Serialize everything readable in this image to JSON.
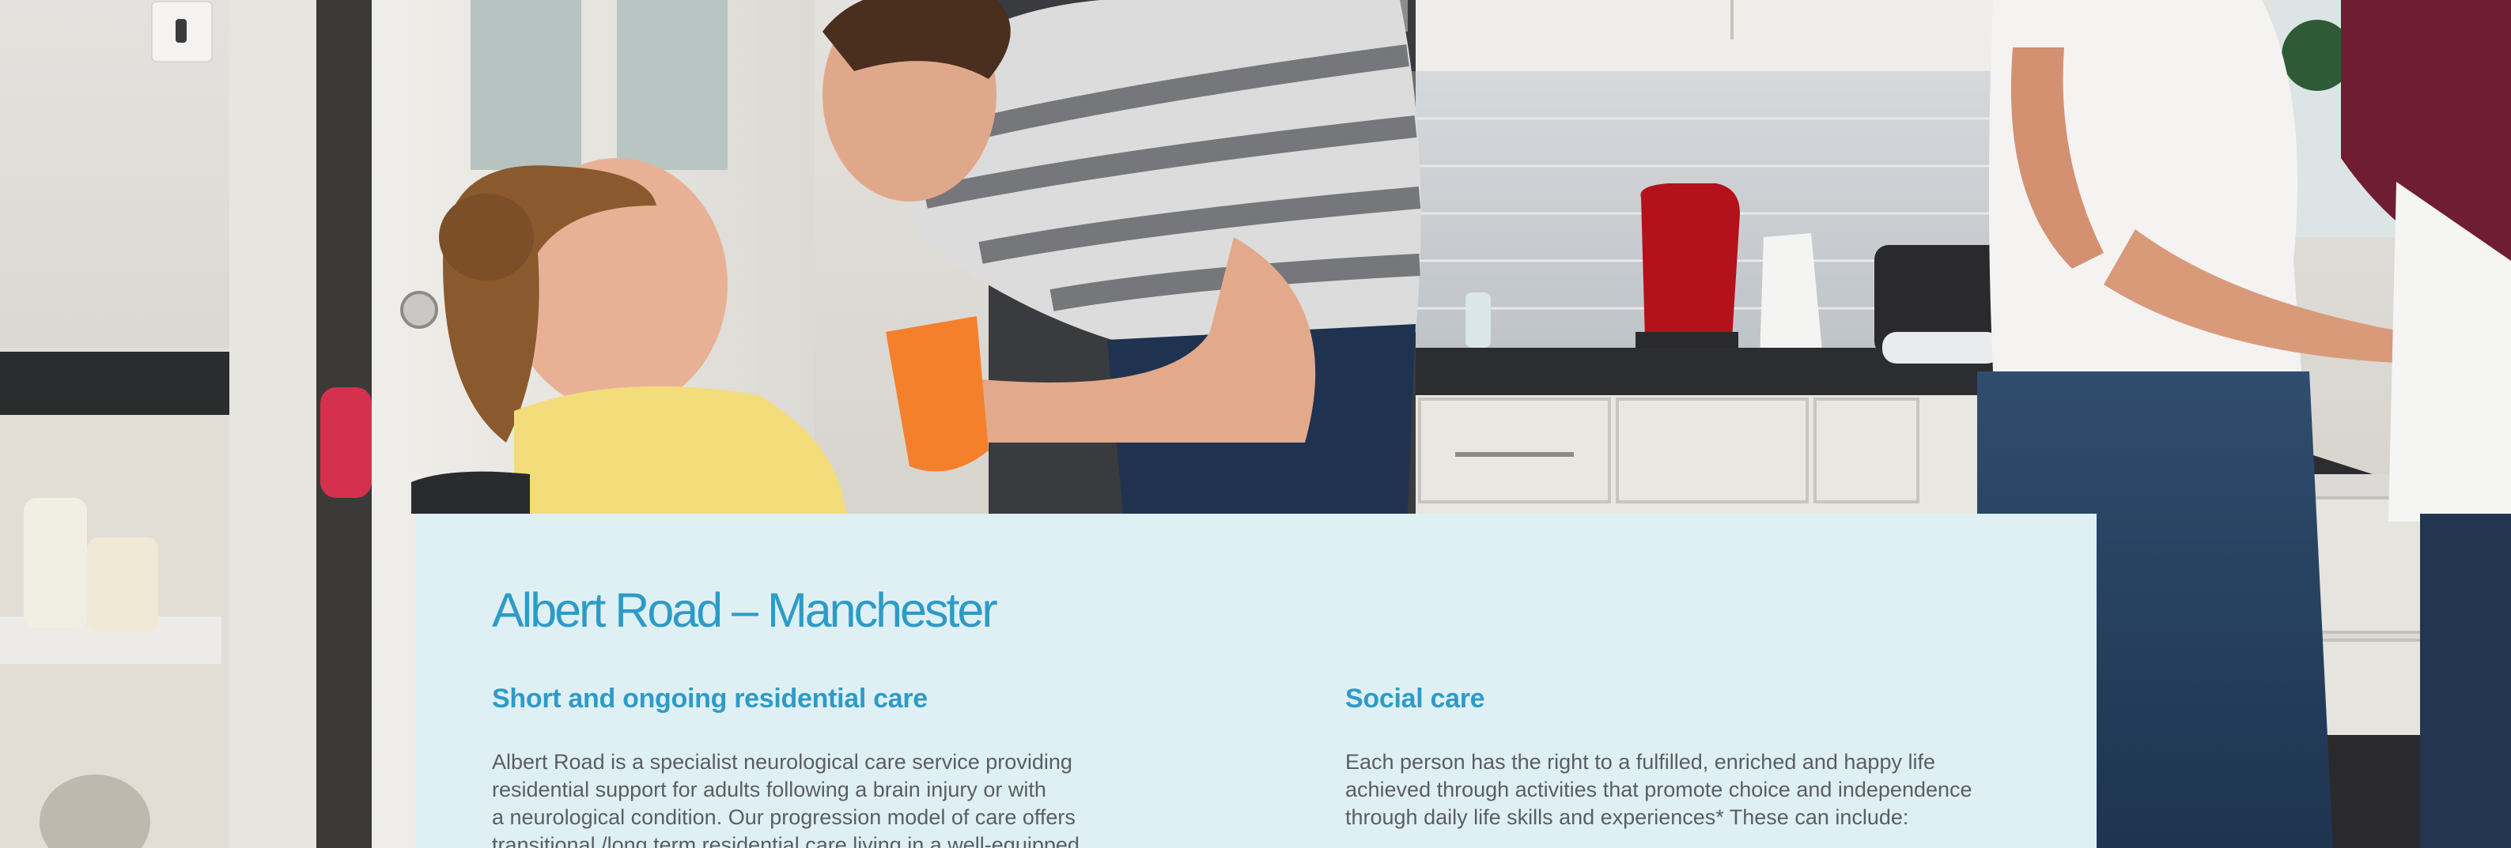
{
  "card": {
    "title": "Albert Road – Manchester",
    "left_column": {
      "heading": "Short and ongoing residential care",
      "body": "Albert Road is a specialist neurological care service providing\nresidential support for adults following a brain injury or with\na neurological condition. Our progression model of care offers\ntransitional /long term residential care living in a well-equipped"
    },
    "right_column": {
      "heading": "Social care",
      "body": "Each person has the right to a fulfilled, enriched and happy life\nachieved through activities that promote choice and independence\nthrough daily life skills and experiences* These can include:"
    }
  },
  "hero": {
    "description_icon": "photo-kitchen-scene",
    "colors": {
      "wall": "#d9d6d0",
      "cabinet": "#e9e7e2",
      "tile": "#c9cdd0",
      "counter": "#2c2d30",
      "kettle": "#b3121a",
      "cup": "#f5802c",
      "sweater": "#f3dc7a",
      "card_bg": "#dff0f5",
      "accent": "#2d9bc8"
    }
  }
}
